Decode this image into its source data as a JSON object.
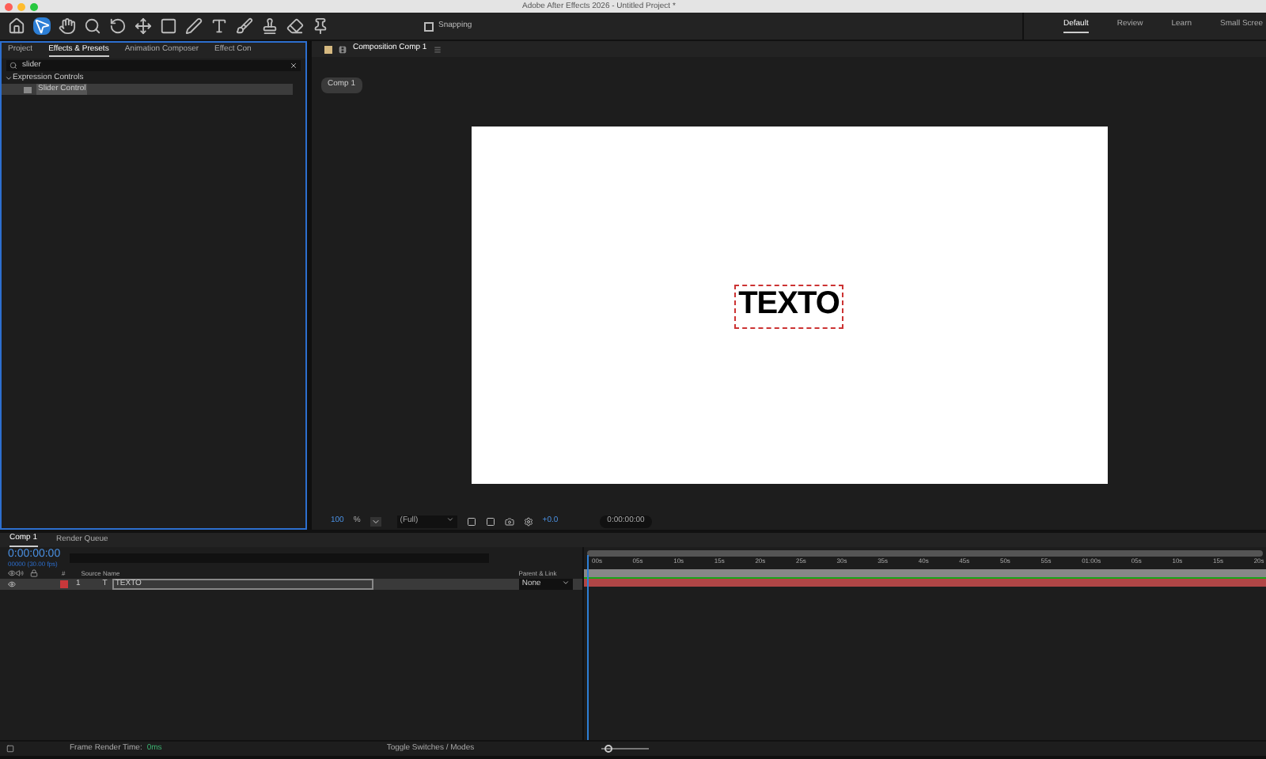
{
  "window": {
    "title": "Adobe After Effects 2026 - Untitled Project *"
  },
  "toolbar": {
    "snapping": {
      "label": "Snapping",
      "checked": false
    }
  },
  "workspaces": [
    {
      "label": "Default",
      "selected": true
    },
    {
      "label": "Review",
      "selected": false
    },
    {
      "label": "Learn",
      "selected": false
    },
    {
      "label": "Small Scree",
      "selected": false
    }
  ],
  "left_panel": {
    "tabs": [
      {
        "label": "Project",
        "selected": false
      },
      {
        "label": "Effects & Presets",
        "selected": true
      },
      {
        "label": "Animation Composer",
        "selected": false
      },
      {
        "label": "Effect Con",
        "selected": false
      }
    ],
    "search": {
      "value": "slider"
    },
    "tree": [
      {
        "label": "Expression Controls",
        "expanded": true,
        "selected": false,
        "children": [
          {
            "label": "Slider Control",
            "selected": true
          }
        ]
      }
    ]
  },
  "composition_panel": {
    "tab": "Composition Comp 1",
    "breadcrumb": "Comp 1",
    "canvas_text": "TEXTO",
    "zoom": "100",
    "zoom_unit": "%",
    "resolution": "(Full)",
    "exposure": "+0.0",
    "timecode": "0:00:00:00"
  },
  "timeline": {
    "tabs": [
      {
        "label": "Comp 1",
        "selected": true
      },
      {
        "label": "Render Queue",
        "selected": false
      }
    ],
    "timecode": "0:00:00:00",
    "frames": "00000 (30.00 fps)",
    "columns": {
      "number": "#",
      "source_name": "Source Name",
      "parent": "Parent & Link"
    },
    "layers": [
      {
        "number": "1",
        "type": "T",
        "name": "TEXTO",
        "parent": "None",
        "color": "#c8383b",
        "selected": true
      }
    ],
    "ruler": [
      "00s",
      "05s",
      "10s",
      "15s",
      "20s",
      "25s",
      "30s",
      "35s",
      "40s",
      "45s",
      "50s",
      "55s",
      "01:00s",
      "05s",
      "10s",
      "15s",
      "20s"
    ]
  },
  "status_bar": {
    "render_label": "Frame Render Time:",
    "render_value": "0ms",
    "toggle": "Toggle Switches / Modes",
    "zoom_slider": {
      "level": 0.1
    }
  }
}
